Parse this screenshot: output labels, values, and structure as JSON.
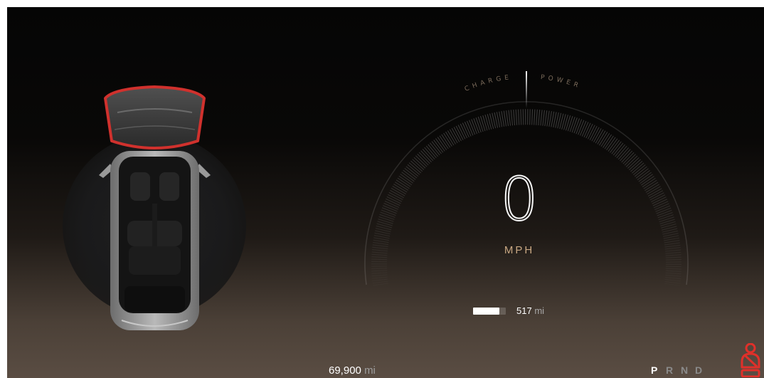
{
  "gauge": {
    "arc_label": "CHARGE POWER",
    "arc_label_left": "CHARGE",
    "arc_label_right": "POWER"
  },
  "speed": {
    "value": "0",
    "unit": "MPH"
  },
  "battery": {
    "level": 0.8,
    "range_value": "517",
    "range_unit": "mi"
  },
  "odometer": {
    "value": "69,900",
    "unit": "mi"
  },
  "gears": [
    {
      "label": "P",
      "active": true
    },
    {
      "label": "R",
      "active": false
    },
    {
      "label": "N",
      "active": false
    },
    {
      "label": "D",
      "active": false
    }
  ],
  "colors": {
    "accent_copper": "#c9a883",
    "door_open_highlight": "#d0312d",
    "warning_red": "#e0302a"
  },
  "icons": {
    "vehicle": "car-top-view-icon",
    "seatbelt": "seatbelt-warning-icon"
  }
}
